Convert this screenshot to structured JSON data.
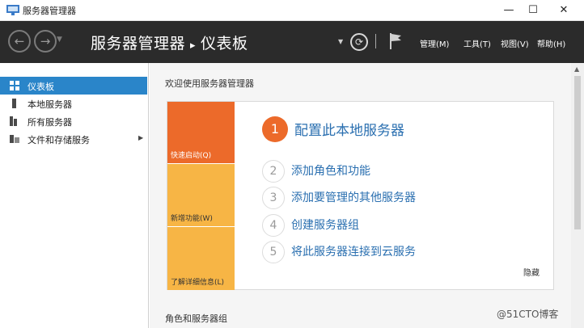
{
  "window": {
    "title": "服务器管理器",
    "minimize": "—",
    "maximize": "☐",
    "close": "✕"
  },
  "header": {
    "back_icon": "←",
    "forward_icon": "→",
    "dropdown_icon": "▼",
    "breadcrumb_root": "服务器管理器",
    "breadcrumb_separator": "▸",
    "breadcrumb_current": "仪表板",
    "refresh_icon": "⟳",
    "menu": [
      "管理(M)",
      "工具(T)",
      "视图(V)",
      "帮助(H)"
    ]
  },
  "sidebar": {
    "items": [
      {
        "label": "仪表板",
        "icon": "dashboard-icon",
        "active": true
      },
      {
        "label": "本地服务器",
        "icon": "server-icon",
        "active": false
      },
      {
        "label": "所有服务器",
        "icon": "servers-icon",
        "active": false
      },
      {
        "label": "文件和存储服务",
        "icon": "storage-icon",
        "active": false,
        "expand": "▶"
      }
    ]
  },
  "main": {
    "welcome": "欢迎使用服务器管理器",
    "tiles": [
      "快速启动(Q)",
      "新增功能(W)",
      "了解详细信息(L)"
    ],
    "steps": [
      {
        "num": "1",
        "label": "配置此本地服务器"
      },
      {
        "num": "2",
        "label": "添加角色和功能"
      },
      {
        "num": "3",
        "label": "添加要管理的其他服务器"
      },
      {
        "num": "4",
        "label": "创建服务器组"
      },
      {
        "num": "5",
        "label": "将此服务器连接到云服务"
      }
    ],
    "hide": "隐藏",
    "roles_header": "角色和服务器组"
  },
  "scrollbar": {
    "up_icon": "▲"
  },
  "watermark": "@51CTO博客",
  "colors": {
    "header_bg": "#2b2b2b",
    "accent_blue": "#2a85c9",
    "tile_orange": "#ec6a2a",
    "tile_yellow": "#f7b545",
    "link_blue": "#2a6fb0"
  }
}
